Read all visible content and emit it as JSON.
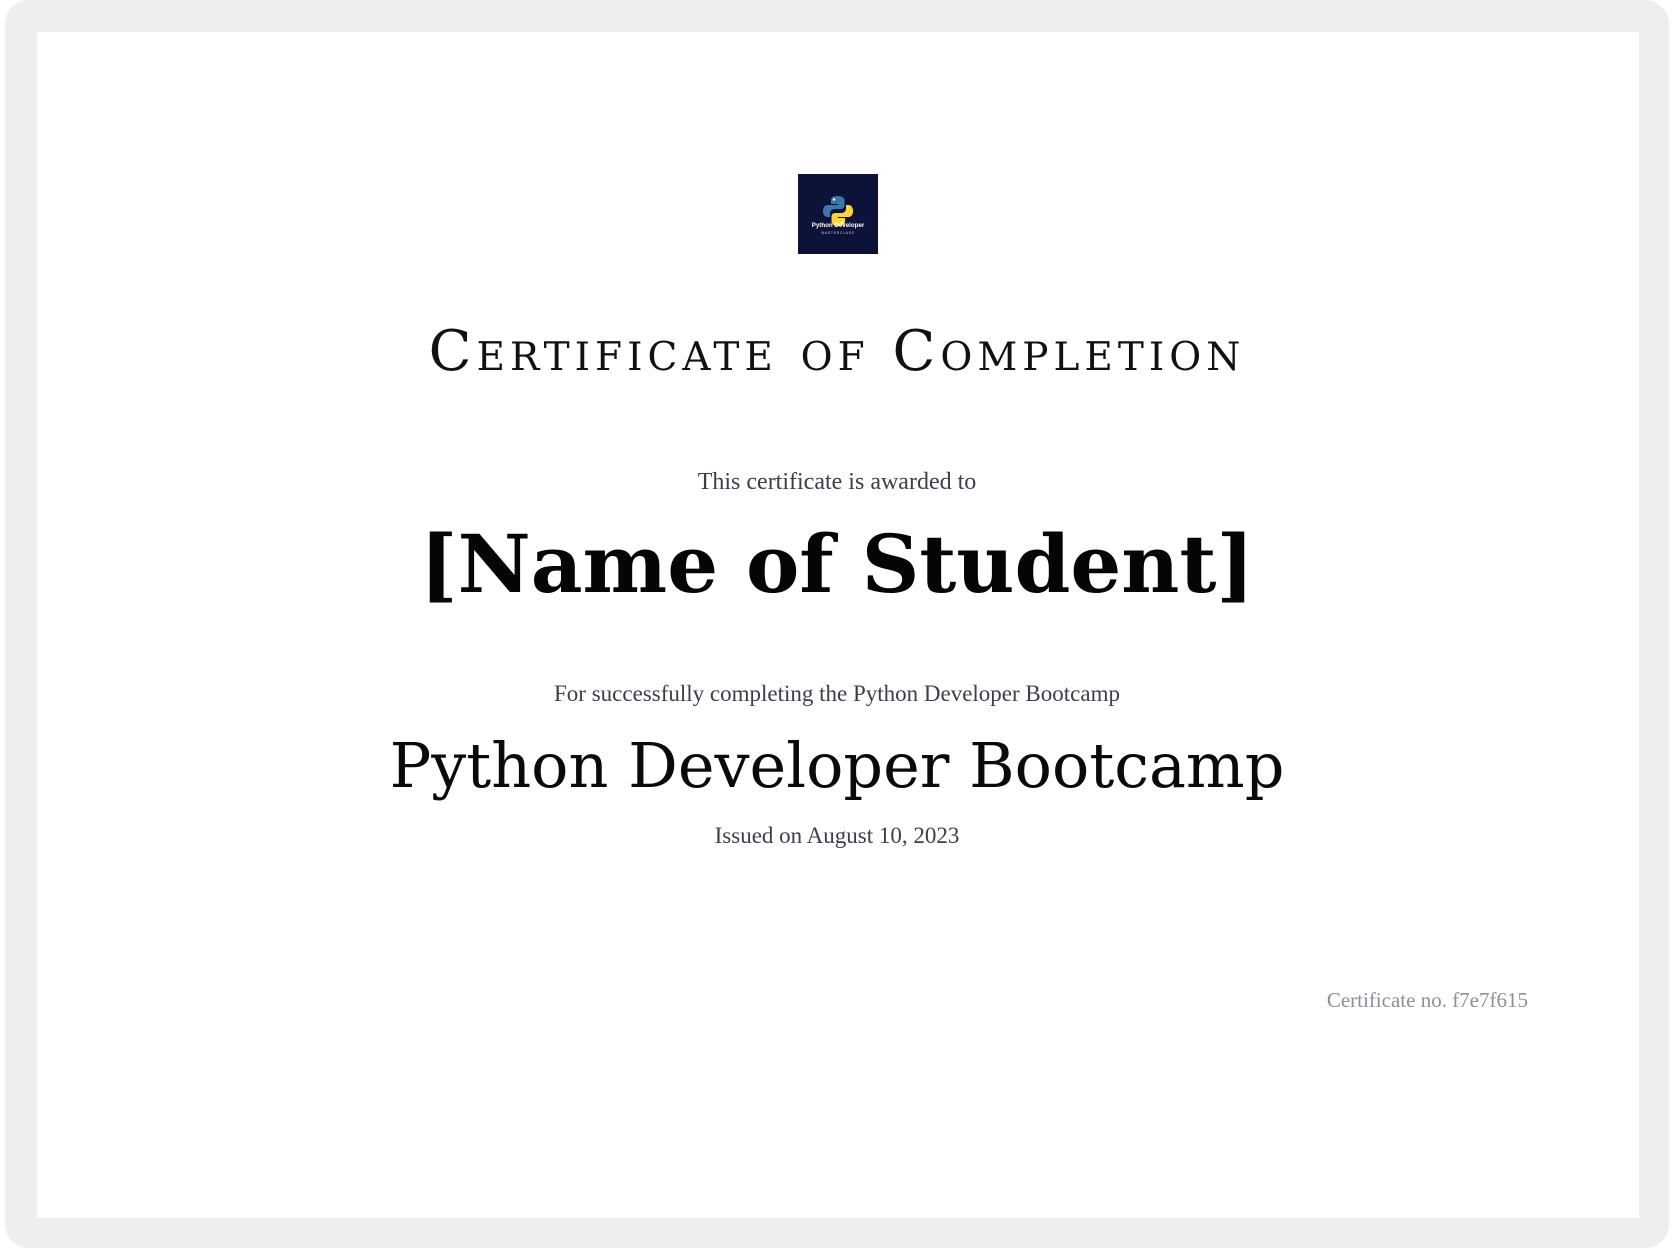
{
  "logo": {
    "name": "Python Developer",
    "tagline": "MASTERCLASS",
    "icon": "python-logo-icon",
    "background_color": "#0c1238"
  },
  "certificate": {
    "title": "Certificate of Completion",
    "awarded_to_text": "This certificate is awarded to",
    "student_name": "[Name of Student]",
    "completion_text": "For successfully completing the Python Developer Bootcamp",
    "course_name": "Python Developer Bootcamp",
    "issued_text": "Issued on August 10, 2023",
    "certificate_number": "Certificate no. f7e7f615"
  },
  "colors": {
    "frame": "#eceef0",
    "sheet": "#ffffff",
    "text_primary": "#0a0a0a",
    "text_secondary": "#3a3f4a",
    "text_muted": "#8a8f99",
    "python_blue": "#3b77a8",
    "python_yellow": "#ffd43b"
  }
}
